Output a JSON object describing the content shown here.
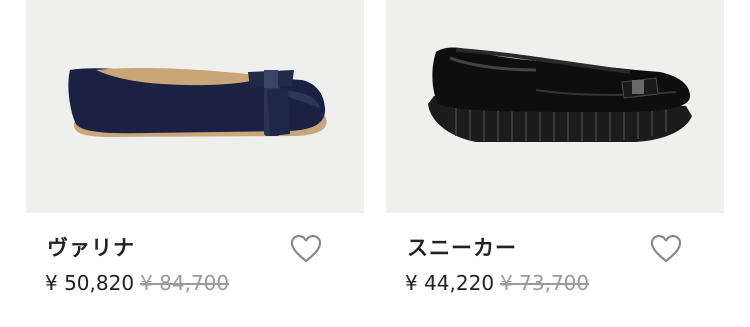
{
  "products": [
    {
      "name": "ヴァリナ",
      "sale_price": "¥ 50,820",
      "original_price": "¥ 84,700",
      "image": "navy-ballet-flat-with-bow",
      "favorite_icon": "heart-outline-icon"
    },
    {
      "name": "スニーカー",
      "sale_price": "¥ 44,220",
      "original_price": "¥ 73,700",
      "image": "black-patent-wedge-sneaker-with-bow",
      "favorite_icon": "heart-outline-icon"
    }
  ],
  "colors": {
    "image_background": "#efefed",
    "text": "#222222",
    "strike_price": "#9a9a9a",
    "heart_stroke": "#8a8a8a"
  }
}
